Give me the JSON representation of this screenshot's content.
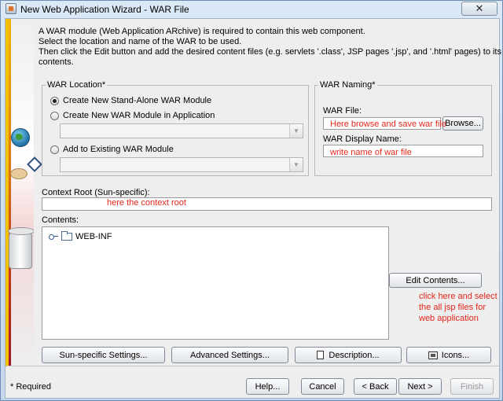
{
  "window": {
    "title": "New Web Application Wizard - WAR File",
    "close_glyph": "✕"
  },
  "description": {
    "line1": "A WAR module (Web Application ARchive) is required to contain this web component.",
    "line2": "Select the location and name of the WAR to be used.",
    "line3": "Then click the Edit button and add the desired content files (e.g. servlets '.class', JSP pages '.jsp', and '.html' pages) to its",
    "line4": "contents."
  },
  "war_location": {
    "legend": "WAR Location*",
    "option_standalone": "Create New Stand-Alone WAR Module",
    "option_in_app": "Create New WAR Module in Application",
    "option_existing": "Add to Existing WAR Module",
    "app_combo_value": "",
    "existing_combo_value": "",
    "selected": "standalone"
  },
  "war_naming": {
    "legend": "WAR Naming*",
    "file_label": "WAR File:",
    "file_value": "",
    "browse_label": "Browse...",
    "display_name_label": "WAR Display Name:",
    "display_name_value": ""
  },
  "context_root": {
    "label": "Context Root (Sun-specific):",
    "value": ""
  },
  "contents": {
    "label": "Contents:",
    "tree": [
      {
        "label": "WEB-INF"
      }
    ],
    "edit_button": "Edit Contents..."
  },
  "annotations": {
    "browse_note": "Here browse and save war file",
    "display_name_note": "write name of war file",
    "context_root_note": "here the context root",
    "edit_note_line1": "click here and select",
    "edit_note_line2": "the all jsp files for",
    "edit_note_line3": "web application",
    "color": "#e4261b"
  },
  "settings_buttons": {
    "sun_specific": "Sun-specific Settings...",
    "advanced": "Advanced Settings...",
    "description": "Description...",
    "icons": "Icons..."
  },
  "footer": {
    "required_note": "* Required",
    "help": "Help...",
    "cancel": "Cancel",
    "back": "< Back",
    "next": "Next >",
    "finish": "Finish"
  },
  "icons": {
    "app": "wizard-app-icon",
    "globe": "globe-icon",
    "jar": "jar-icon",
    "folder": "folder-icon",
    "description": "document-icon",
    "icons_button": "image-icon"
  },
  "art_colors": [
    "#f2c200",
    "#e07a10",
    "#c73a1e",
    "#a0142a"
  ]
}
